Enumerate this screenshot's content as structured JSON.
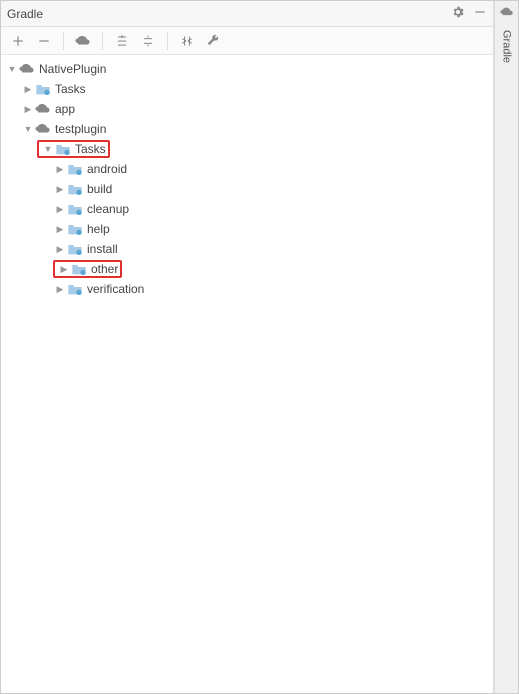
{
  "panel": {
    "title": "Gradle"
  },
  "sidebar": {
    "label": "Gradle"
  },
  "tree": {
    "root": {
      "label": "NativePlugin",
      "children": [
        {
          "label": "Tasks"
        },
        {
          "label": "app"
        },
        {
          "label": "testplugin",
          "children": {
            "tasks": {
              "label": "Tasks",
              "items": [
                {
                  "label": "android"
                },
                {
                  "label": "build"
                },
                {
                  "label": "cleanup"
                },
                {
                  "label": "help"
                },
                {
                  "label": "install"
                },
                {
                  "label": "other"
                },
                {
                  "label": "verification"
                }
              ]
            }
          }
        }
      ]
    }
  }
}
